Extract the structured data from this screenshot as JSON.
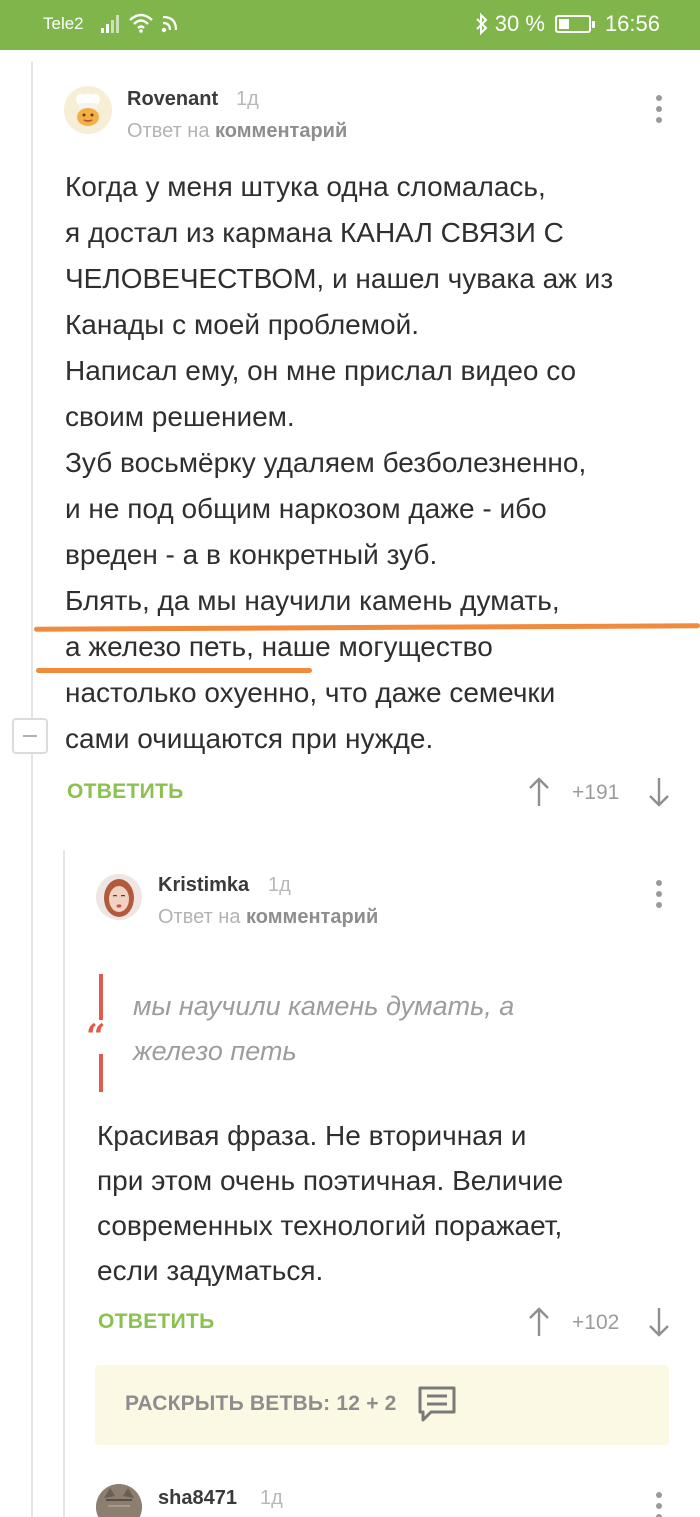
{
  "status_bar": {
    "carrier": "Tele2",
    "battery": "30 %",
    "battery_level": 0.3,
    "time": "16:56"
  },
  "comments": [
    {
      "author": "Rovenant",
      "time": "1д",
      "reply_prefix": "Ответ на",
      "reply_link": "комментарий",
      "lines": [
        "Когда у меня штука одна сломалась,",
        "я достал из кармана КАНАЛ СВЯЗИ С",
        "ЧЕЛОВЕЧЕСТВОМ, и нашел чувака аж из",
        "Канады с моей проблемой.",
        "Написал ему, он мне прислал видео со",
        "своим решением.",
        "Зуб восьмёрку удаляем безболезненно,",
        "и не под общим наркозом даже - ибо",
        "вреден - а в конкретный зуб.",
        "Блять, да мы научили камень думать,",
        "а железо петь, наше могущество",
        "настолько охуенно, что даже семечки",
        "сами очищаются при нужде."
      ],
      "reply_label": "ОТВЕТИТЬ",
      "score": "+191"
    },
    {
      "author": "Kristimka",
      "time": "1д",
      "reply_prefix": "Ответ на",
      "reply_link": "комментарий",
      "quote_mark": "“",
      "quote_lines": [
        "мы научили камень думать, а",
        "железо петь"
      ],
      "lines": [
        "Красивая фраза. Не вторичная и",
        "при этом очень поэтичная. Величие",
        "современных технологий поражает,",
        "если задуматься."
      ],
      "reply_label": "ОТВЕТИТЬ",
      "score": "+102",
      "expand_label": "РАСКРЫТЬ ВЕТВЬ: 12 + 2"
    },
    {
      "author": "sha8471",
      "time": "1д"
    }
  ],
  "colors": {
    "status_bar": "#7fb54a",
    "reply_green": "#8ac14f",
    "quote_red": "#e05a4d",
    "highlight_orange": "#f08b3e",
    "expand_bg": "#fbf8e4"
  }
}
